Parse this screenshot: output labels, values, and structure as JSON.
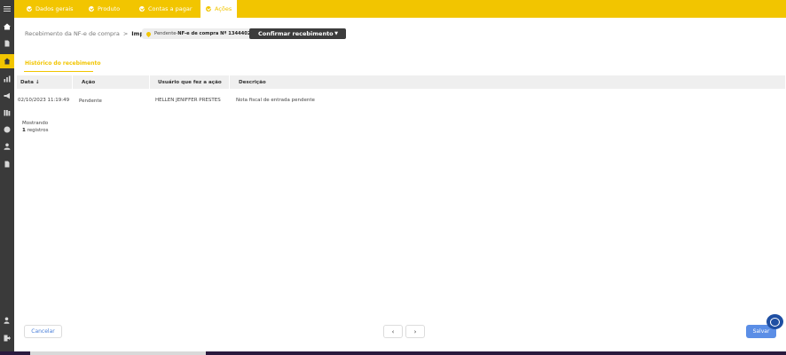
{
  "tabs": [
    {
      "label": "Dados gerais",
      "active": false
    },
    {
      "label": "Produto",
      "active": false
    },
    {
      "label": "Contas a pagar",
      "active": false
    },
    {
      "label": "Ações",
      "active": true
    }
  ],
  "breadcrumb": {
    "parent": "Recebimento da NF-e de compra",
    "separator": ">",
    "current": "Importar"
  },
  "status": {
    "state": "Pendente",
    "dash": " - ",
    "document": "NF-e de compra Nº 13444022"
  },
  "confirm_button": {
    "label": "Confirmar recebimento"
  },
  "section": {
    "title": "Histórico do recebimento"
  },
  "table": {
    "columns": [
      "Data",
      "Ação",
      "Usuário que fez a ação",
      "Descrição"
    ],
    "sort_indicator": "↓",
    "rows": [
      {
        "date": "02/10/2023 11:19:49",
        "action": "Pendente",
        "user": "HELLEN JENIFFER PRESTES",
        "description": "Nota fiscal de entrada pendente"
      }
    ]
  },
  "pagination_summary": {
    "label": "Mostrando",
    "count": "1",
    "unit": "registros"
  },
  "footer": {
    "cancel_label": "Cancelar",
    "prev_label": "‹",
    "next_label": "›",
    "save_label": "Salvar"
  },
  "colors": {
    "accent": "#f2c500",
    "rail": "#3a3a3a",
    "save": "#5b8ee6",
    "link": "#4a7fd9"
  },
  "rail_icons": [
    "menu-icon",
    "home-icon",
    "document-icon",
    "shop-icon",
    "chart-icon",
    "megaphone-icon",
    "library-icon",
    "coin-icon",
    "user-icon",
    "file-icon",
    "user-settings-icon",
    "logout-icon"
  ]
}
